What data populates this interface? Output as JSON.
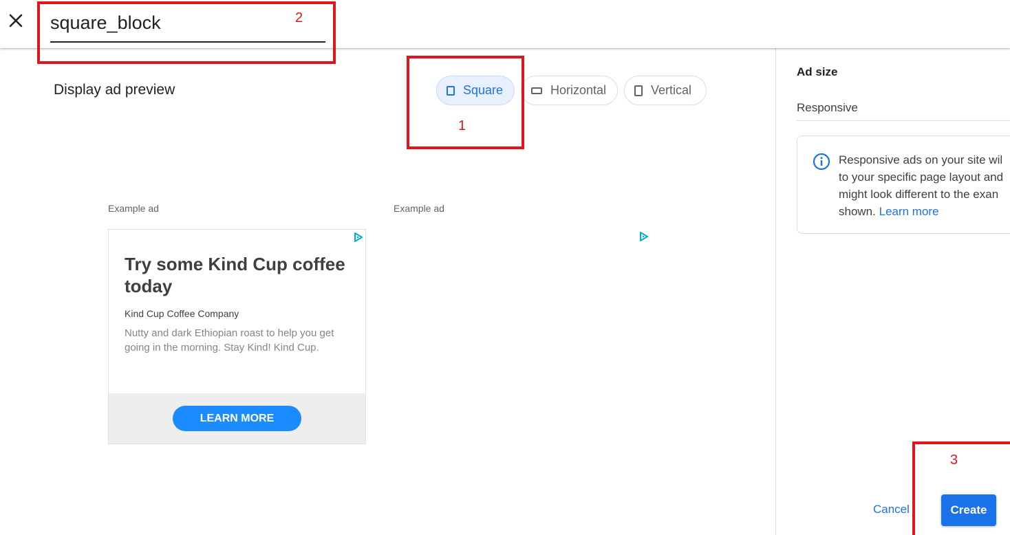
{
  "header": {
    "close_icon": "close-icon",
    "ad_unit_name": "square_block"
  },
  "preview": {
    "title": "Display ad preview",
    "format_chips": [
      {
        "label": "Square",
        "icon": "square-icon",
        "selected": true
      },
      {
        "label": "Horizontal",
        "icon": "horizontal-rect-icon",
        "selected": false
      },
      {
        "label": "Vertical",
        "icon": "vertical-rect-icon",
        "selected": false
      }
    ],
    "examples": [
      {
        "label": "Example ad",
        "headline": "Try some Kind Cup coffee today",
        "company": "Kind Cup Coffee Company",
        "description": "Nutty and dark Ethiopian roast to help you get going in the morning. Stay Kind! Kind Cup.",
        "cta": "LEARN MORE"
      },
      {
        "label": "Example ad"
      }
    ]
  },
  "side_panel": {
    "ad_size_title": "Ad size",
    "ad_size_value": "Responsive",
    "info": {
      "line1": "Responsive ads on your site wil",
      "line2": "to your specific page layout and",
      "line3": "might look different to the exan",
      "line4_prefix": "shown.",
      "link": "Learn more"
    },
    "cancel_label": "Cancel",
    "create_label": "Create"
  },
  "annotations": [
    "1",
    "2",
    "3"
  ],
  "colors": {
    "accent": "#1a73e8",
    "cta_blue": "#1a8cff",
    "annotation_red": "#e0161e",
    "chip_selected_bg": "#e8f0fe"
  }
}
